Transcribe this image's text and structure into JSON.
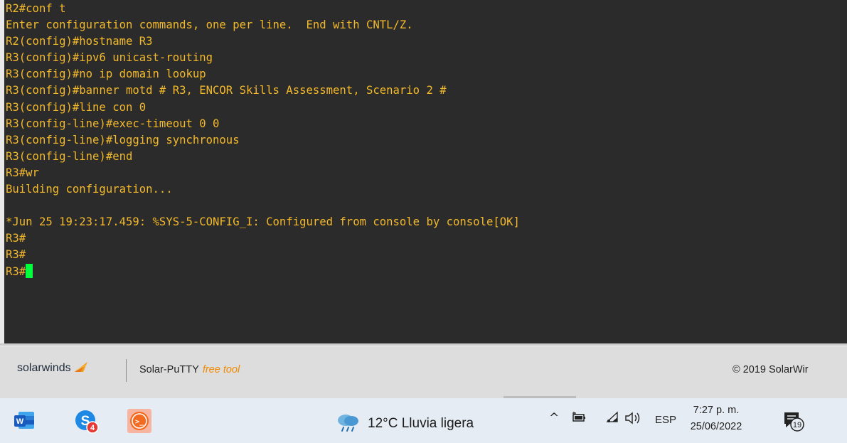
{
  "terminal": {
    "lines": [
      "R2#conf t",
      "Enter configuration commands, one per line.  End with CNTL/Z.",
      "R2(config)#hostname R3",
      "R3(config)#ipv6 unicast-routing",
      "R3(config)#no ip domain lookup",
      "R3(config)#banner motd # R3, ENCOR Skills Assessment, Scenario 2 #",
      "R3(config)#line con 0",
      "R3(config-line)#exec-timeout 0 0",
      "R3(config-line)#logging synchronous",
      "R3(config-line)#end",
      "R3#wr",
      "Building configuration...",
      "",
      "*Jun 25 19:23:17.459: %SYS-5-CONFIG_I: Configured from console by console[OK]",
      "R3#",
      "R3#"
    ],
    "prompt": "R3#",
    "text_color": "#f3b92b",
    "background_color": "#2b2b2b",
    "cursor_color": "#00ff3c"
  },
  "footer": {
    "brand": "solarwinds",
    "brand_icon": "solarwinds-flame-icon",
    "app_name": "Solar-PuTTY",
    "app_tag": "free tool",
    "copyright": "© 2019 SolarWir"
  },
  "taskbar": {
    "apps": [
      {
        "name": "word-icon",
        "letter": "W"
      },
      {
        "name": "skype-icon",
        "letter": "S",
        "badge": "4"
      },
      {
        "name": "solar-putty-icon",
        "letter": ">_"
      }
    ],
    "weather": {
      "icon": "rain-cloud-icon",
      "text": "12°C  Lluvia ligera"
    },
    "tray": {
      "chevron": "^",
      "language": "ESP"
    },
    "clock": {
      "time": "7:27 p. m.",
      "date": "25/06/2022"
    },
    "notifications": {
      "count": "19"
    }
  }
}
